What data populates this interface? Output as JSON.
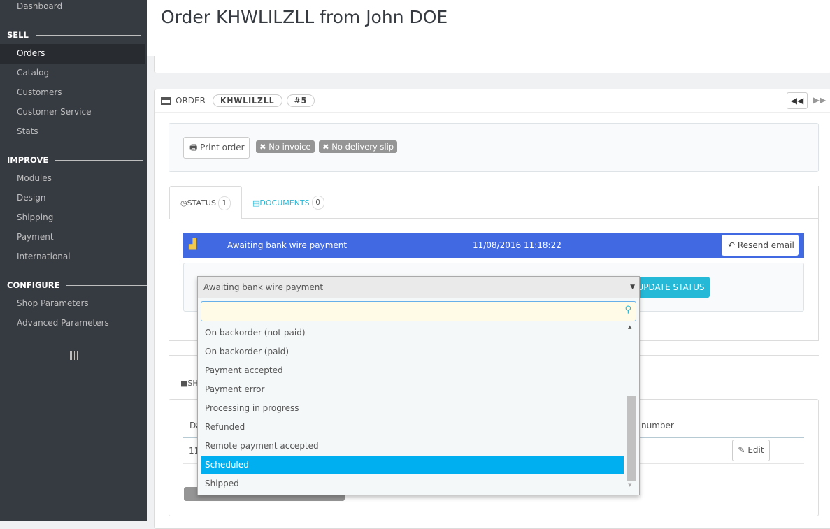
{
  "sidebar": {
    "dashboard": "Dashboard",
    "sections": [
      {
        "title": "SELL",
        "items": [
          "Orders",
          "Catalog",
          "Customers",
          "Customer Service",
          "Stats"
        ]
      },
      {
        "title": "IMPROVE",
        "items": [
          "Modules",
          "Design",
          "Shipping",
          "Payment",
          "International"
        ]
      },
      {
        "title": "CONFIGURE",
        "items": [
          "Shop Parameters",
          "Advanced Parameters"
        ]
      }
    ],
    "active": "Orders"
  },
  "header": {
    "title": "Order KHWLILZLL from John DOE"
  },
  "order": {
    "label": "ORDER",
    "reference": "KHWLILZLL",
    "id": "#5",
    "print": "Print order",
    "no_invoice": "No invoice",
    "no_delivery": "No delivery slip"
  },
  "tabs": [
    {
      "label": "STATUS",
      "count": "1"
    },
    {
      "label": "DOCUMENTS",
      "count": "0"
    }
  ],
  "status": {
    "name": "Awaiting bank wire payment",
    "date": "11/08/2016 11:18:22",
    "resend": "Resend email",
    "color": "#4169e1"
  },
  "select": {
    "value": "Awaiting bank wire payment",
    "update": "UPDATE STATUS",
    "search_value": "",
    "options": [
      "On backorder (not paid)",
      "On backorder (paid)",
      "Payment accepted",
      "Payment error",
      "Processing in progress",
      "Refunded",
      "Remote payment accepted",
      "Scheduled",
      "Shipped"
    ],
    "highlighted": "Scheduled"
  },
  "shipping": {
    "title_partial": "SH",
    "col_date_partial": "Da",
    "col_number_partial": "number",
    "row_date_partial": "11",
    "edit": "Edit"
  }
}
